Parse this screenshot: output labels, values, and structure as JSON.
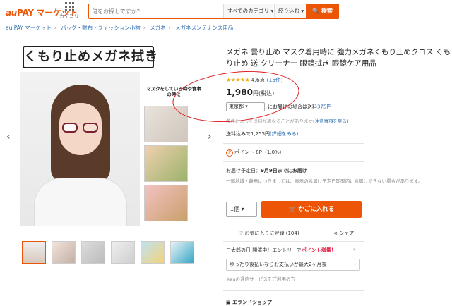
{
  "header": {
    "logo_au": "au",
    "logo_rest": "PAY マーケット",
    "category_label": "カテゴリ",
    "search_placeholder": "何をお探しですか？",
    "all_categories": "すべてのカテゴリ ▾",
    "refine": "絞り込む ▾",
    "search_button": "🔍 検索"
  },
  "breadcrumb": [
    "au PAY マーケット",
    "バッグ・財布・ファッション小物",
    "メガネ",
    "メガネメンテナンス用品"
  ],
  "gallery": {
    "banner": "くもり止めメガネ拭き",
    "callout": "マスクをしている時や食事の時に",
    "prev": "‹",
    "next": "›"
  },
  "product": {
    "title": "メガネ 曇り止め マスク着用時に 強力メガネくもり止めクロス くもり止め 送 クリーナー 眼鏡拭き 眼鏡ケア用品",
    "stars": "★★★★★",
    "rating": "4.6点",
    "review_count": "(15件)",
    "price": "1,980",
    "price_unit": "円(税込)",
    "prefecture": "東京都 ▾",
    "shipping_text": "にお届けの場合は送料",
    "shipping_cost": "375円",
    "condition_note": "条件によって送料が異なることがあります",
    "condition_link": "(注意事項を見る)",
    "total_text": "送料込みで1,255円",
    "total_link": "(詳細をみる)",
    "points_icon": "P",
    "points_text": "ポイント 8P（1.0%）",
    "delivery_label": "お届け予定日：",
    "delivery_value": "9月9日までにお届け",
    "delivery_note": "一部地域・離島につきましては、表示のお届け予定日期間内にお届けできない場合があります。",
    "quantity": "1個 ▾",
    "cart_button": "🛒 かごに入れる",
    "favorite": "♡ お気に入りに登録 (104)",
    "share": "⋖ シェア",
    "campaign_pre": "三太郎の日 開催中！エントリーで",
    "campaign_pt": "ポイント増量！",
    "campaign_chev": "›",
    "installment": "ゆったり後払いならお支払いが最大2ヶ月後",
    "installment_chev": "›",
    "au_note": "※auの通信サービスをご利用の方",
    "shop": "▣ エランドショップ"
  }
}
